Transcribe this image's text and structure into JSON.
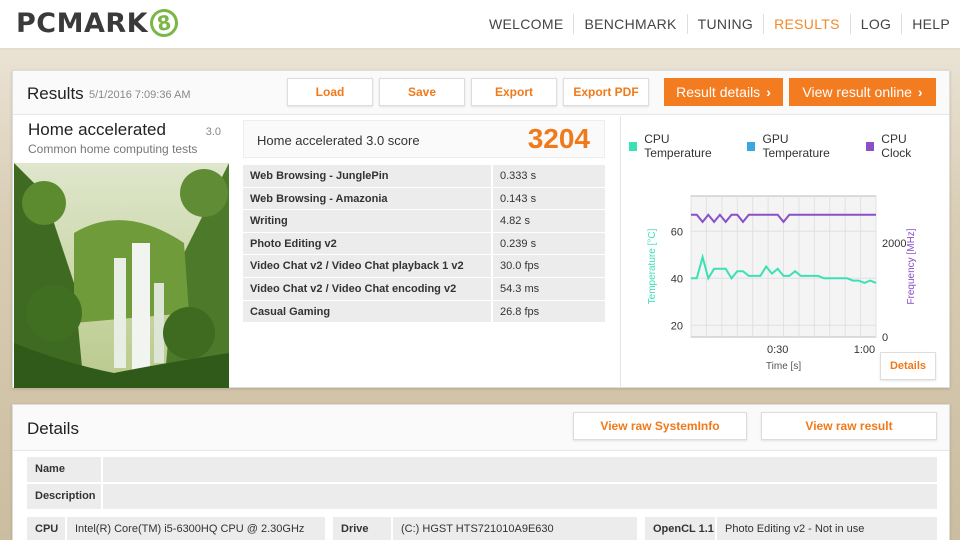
{
  "app": {
    "logo_text": "PCMARK",
    "logo_badge": "8"
  },
  "nav": {
    "items": [
      "WELCOME",
      "BENCHMARK",
      "TUNING",
      "RESULTS",
      "LOG",
      "HELP"
    ],
    "active": "RESULTS"
  },
  "results": {
    "title": "Results",
    "date": "5/1/2016 7:09:36 AM",
    "buttons": {
      "load": "Load",
      "save": "Save",
      "export": "Export",
      "export_pdf": "Export PDF",
      "result_details": "Result details",
      "view_online": "View result online"
    },
    "test": {
      "name": "Home accelerated",
      "version": "3.0",
      "description": "Common home computing tests"
    },
    "score": {
      "label": "Home accelerated 3.0 score",
      "value": "3204"
    },
    "subtests": [
      {
        "name": "Web Browsing - JunglePin",
        "value": "0.333 s"
      },
      {
        "name": "Web Browsing - Amazonia",
        "value": "0.143 s"
      },
      {
        "name": "Writing",
        "value": "4.82 s"
      },
      {
        "name": "Photo Editing v2",
        "value": "0.239 s"
      },
      {
        "name": "Video Chat v2 / Video Chat playback 1 v2",
        "value": "30.0 fps"
      },
      {
        "name": "Video Chat v2 / Video Chat encoding v2",
        "value": "54.3 ms"
      },
      {
        "name": "Casual Gaming",
        "value": "26.8 fps"
      }
    ],
    "details_button": "Details"
  },
  "chart_data": {
    "type": "line",
    "legend": [
      "CPU Temperature",
      "GPU Temperature",
      "CPU Clock"
    ],
    "colors": {
      "cpu_temp": "#3de0b4",
      "gpu_temp": "#3aa8e0",
      "cpu_clock": "#8a4fc9",
      "accent": "#f47c20"
    },
    "xlabel": "Time [s]",
    "ylabel_left": "Temperature [°C]",
    "ylabel_right": "Frequency [MHz]",
    "x_ticks": [
      "0:30",
      "1:00"
    ],
    "y_left_ticks": [
      "20",
      "40",
      "60"
    ],
    "y_right_ticks": [
      "0",
      "2000"
    ],
    "xlim": [
      0,
      64
    ],
    "ylim_left": [
      15,
      75
    ],
    "ylim_right": [
      0,
      3000
    ],
    "series": [
      {
        "name": "CPU Temperature",
        "axis": "left",
        "x": [
          0,
          2,
          4,
          6,
          8,
          10,
          12,
          14,
          16,
          18,
          20,
          22,
          24,
          26,
          28,
          30,
          32,
          34,
          36,
          38,
          40,
          42,
          44,
          46,
          48,
          50,
          52,
          54,
          56,
          58,
          60,
          62,
          64
        ],
        "values": [
          40,
          40,
          49,
          40,
          44,
          44,
          44,
          40,
          43,
          43,
          41,
          41,
          41,
          45,
          42,
          44,
          41,
          41,
          43,
          41,
          41,
          41,
          41,
          40,
          40,
          40,
          40,
          40,
          39,
          39,
          38,
          39,
          38
        ]
      },
      {
        "name": "CPU Clock",
        "axis": "right",
        "x": [
          0,
          2,
          4,
          6,
          8,
          10,
          12,
          14,
          16,
          18,
          20,
          22,
          24,
          26,
          28,
          30,
          32,
          34,
          36,
          38,
          40,
          42,
          44,
          46,
          48,
          50,
          52,
          54,
          56,
          58,
          60,
          62,
          64
        ],
        "values": [
          2600,
          2600,
          2450,
          2600,
          2450,
          2600,
          2450,
          2600,
          2600,
          2450,
          2600,
          2600,
          2600,
          2600,
          2600,
          2600,
          2450,
          2600,
          2600,
          2600,
          2600,
          2600,
          2600,
          2600,
          2600,
          2600,
          2600,
          2600,
          2600,
          2600,
          2600,
          2600,
          2600
        ]
      }
    ]
  },
  "details": {
    "title": "Details",
    "buttons": {
      "raw_sysinfo": "View raw SystemInfo",
      "raw_result": "View raw result"
    },
    "name_label": "Name",
    "description_label": "Description",
    "specs": {
      "cpu_label": "CPU",
      "cpu_value": "Intel(R) Core(TM) i5-6300HQ CPU @ 2.30GHz",
      "drive_label": "Drive",
      "drive_value": "(C:) HGST HTS721010A9E630",
      "opencl_label": "OpenCL 1.1",
      "opencl_value": "Photo Editing v2 - Not in use"
    }
  }
}
